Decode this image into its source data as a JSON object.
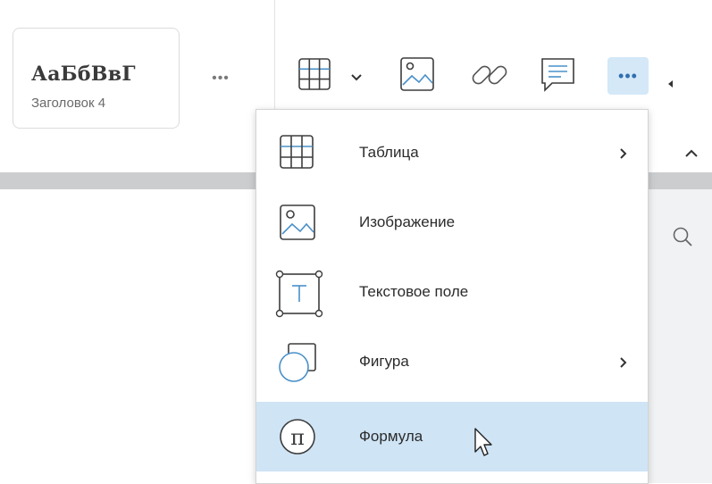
{
  "style_panel": {
    "preview_text": "АаБбВвГ",
    "style_name": "Заголовок 4",
    "more_label": "•••"
  },
  "toolbar": {
    "icons": [
      "table-icon",
      "dropdown-chevron-icon",
      "image-icon",
      "link-icon",
      "comment-icon",
      "more-icon"
    ],
    "more_label": "•••"
  },
  "insert_menu": {
    "items": [
      {
        "label": "Таблица",
        "icon": "table-icon",
        "has_submenu": true
      },
      {
        "label": "Изображение",
        "icon": "image-icon",
        "has_submenu": false
      },
      {
        "label": "Текстовое поле",
        "icon": "text-box-icon",
        "has_submenu": false
      },
      {
        "label": "Фигура",
        "icon": "shape-icon",
        "has_submenu": true
      },
      {
        "label": "Формула",
        "icon": "formula-icon",
        "has_submenu": false,
        "selected": true
      }
    ]
  },
  "colors": {
    "accent": "#2f6fb0",
    "selected_bg": "#cfe4f5",
    "icon_blue": "#4a90c8"
  }
}
